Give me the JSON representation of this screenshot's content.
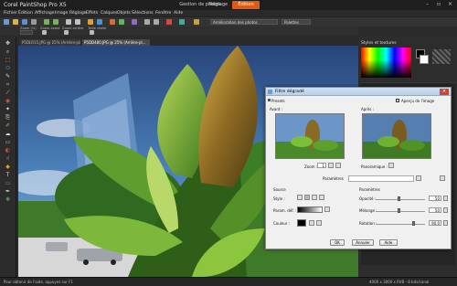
{
  "app": {
    "title": "Corel PaintShop Pro X5",
    "title_brand": "PaintShop",
    "workspace_tabs": [
      "Gestion de photos",
      "Réglage",
      "Édition"
    ],
    "active_tab": "Édition"
  },
  "menu": [
    "Fichier",
    "Édition",
    "Affichage",
    "Image",
    "Réglage",
    "Effets",
    "Calques",
    "Objets",
    "Sélections",
    "Fenêtre",
    "Aide"
  ],
  "toolbar": {
    "mode_select": "Amélioration des photos",
    "palettes_select": "Palettes"
  },
  "tool_options": {
    "labels": [
      "Zoom (%)",
      "Zoom avant",
      "Zoom arrière",
      "Taille réelle"
    ]
  },
  "document_tabs": [
    "P5DLR15.JPG @ 25% (Arrière-plan)",
    "P5DD480.JPG @ 25% (Arrière-pl..."
  ],
  "palette": {
    "title": "Styles et textures"
  },
  "status": {
    "left": "Pour obtenir de l'aide, appuyez sur F1",
    "right": "4000 x 3000 x RVB - 8 bits/canal"
  },
  "dialog": {
    "title": "Filtre dégradé",
    "presets_label": "Presets",
    "preview_checkbox": "Aperçu de l'image",
    "before_label": "Avant :",
    "after_label": "Après :",
    "zoom_label": "Zoom :",
    "zoom_value": "1",
    "panoramique_label": "Panoramique :",
    "parametres_dropdown_label": "Paramètres",
    "source_section": "Source",
    "parametres_section": "Paramètres",
    "style_label": "Style :",
    "preset_label": "Param. déf. :",
    "couleur_label": "Couleur :",
    "opacite_label": "Opacité :",
    "opacite_value": "50",
    "melange_label": "Mélange :",
    "melange_value": "50",
    "rotation_label": "Rotation :",
    "rotation_value": "90.0",
    "ok": "OK",
    "annuler": "Annuler",
    "aide": "Aide"
  },
  "colors": {
    "accent": "#e05a12",
    "panel_bg": "#2d2d2d",
    "dialog_bg": "#f0f0f0"
  }
}
